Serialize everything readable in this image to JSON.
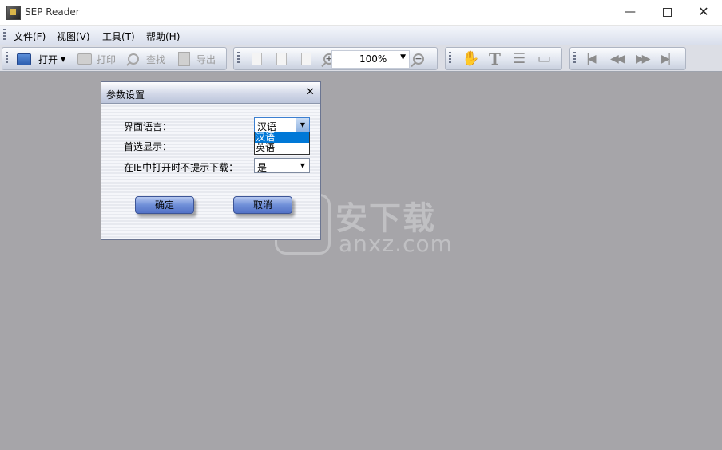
{
  "window": {
    "title": "SEP Reader",
    "minimize": "—",
    "close": "✕"
  },
  "menu": {
    "file": "文件(F)",
    "view": "视图(V)",
    "tools": "工具(T)",
    "help": "帮助(H)"
  },
  "toolbar": {
    "open": "打开",
    "print": "打印",
    "find": "查找",
    "export": "导出",
    "zoom_value": "100%",
    "text_tool": "T",
    "nav_first": "|◀",
    "nav_prev": "◀◀",
    "nav_next": "▶▶",
    "nav_last": "▶|"
  },
  "dialog": {
    "title": "参数设置",
    "close": "✕",
    "fields": {
      "language_label": "界面语言：",
      "language_value": "汉语",
      "display_label": "首选显示：",
      "ie_label": "在IE中打开时不提示下载：",
      "ie_value": "是"
    },
    "language_options": [
      "汉语",
      "英语"
    ],
    "ok": "确定",
    "cancel": "取消"
  },
  "watermark": {
    "cn": "安下载",
    "en": "anxz.com",
    "glyph": "安"
  },
  "colors": {
    "workspace": "#a6a5a9",
    "selection": "#0078d7",
    "button": "#6f8fd8"
  }
}
